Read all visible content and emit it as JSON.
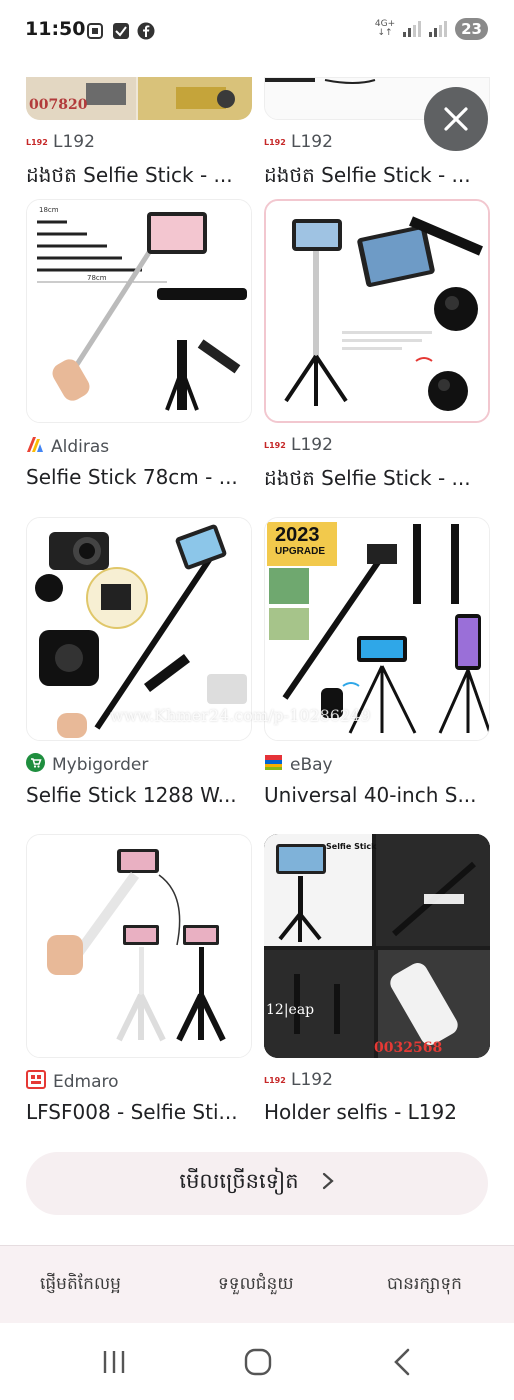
{
  "status_bar": {
    "time": "11:50",
    "left_icons": [
      "screenshot-icon",
      "check-box-icon",
      "facebook-icon"
    ],
    "network": "4G+",
    "battery": "23"
  },
  "results": [
    {
      "source": "L192",
      "source_logo": "l192-logo",
      "title": "ដងថត Selfie Stick - ...",
      "image_caption": "007820",
      "partial": true
    },
    {
      "source": "L192",
      "source_logo": "l192-logo",
      "title": "ដងថត Selfie Stick - ...",
      "partial": true
    },
    {
      "source": "Aldiras",
      "source_logo": "aldiras-logo",
      "title": "Selfie Stick 78cm - ...",
      "image_labels": [
        "18cm",
        "78cm"
      ]
    },
    {
      "source": "L192",
      "source_logo": "l192-logo",
      "title": "ដងថត Selfie Stick - ..."
    },
    {
      "source": "Mybigorder",
      "source_logo": "mybigorder-logo",
      "title": "Selfie Stick 1288 W..."
    },
    {
      "source": "eBay",
      "source_logo": "ebay-logo",
      "title": "Universal 40-inch S...",
      "image_labels": [
        "2023",
        "UPGRADE"
      ]
    },
    {
      "source": "Edmaro",
      "source_logo": "edmaro-logo",
      "title": "LFSF008 - Selfie Sti..."
    },
    {
      "source": "L192",
      "source_logo": "l192-logo",
      "title": "Holder selfis - L192",
      "image_labels": [
        "Selfie Stick",
        "12|eap",
        "0032568"
      ]
    }
  ],
  "watermark": "www.Khmer24.com/p-10286249",
  "more_button": {
    "label": "មើលច្រើនទៀត",
    "icon": "chevron-right-icon"
  },
  "bottom_tabs": [
    {
      "label": "ផ្ញើមតិកែលម្អ"
    },
    {
      "label": "ទទួលជំនួយ"
    },
    {
      "label": "បានរក្សាទុក"
    }
  ],
  "nav_bar": {
    "icons": [
      "recent-apps-icon",
      "home-icon",
      "back-icon"
    ]
  },
  "colors": {
    "accent_red": "#c62828",
    "fab": "#5f6163",
    "more_bg": "#f6eff1"
  }
}
